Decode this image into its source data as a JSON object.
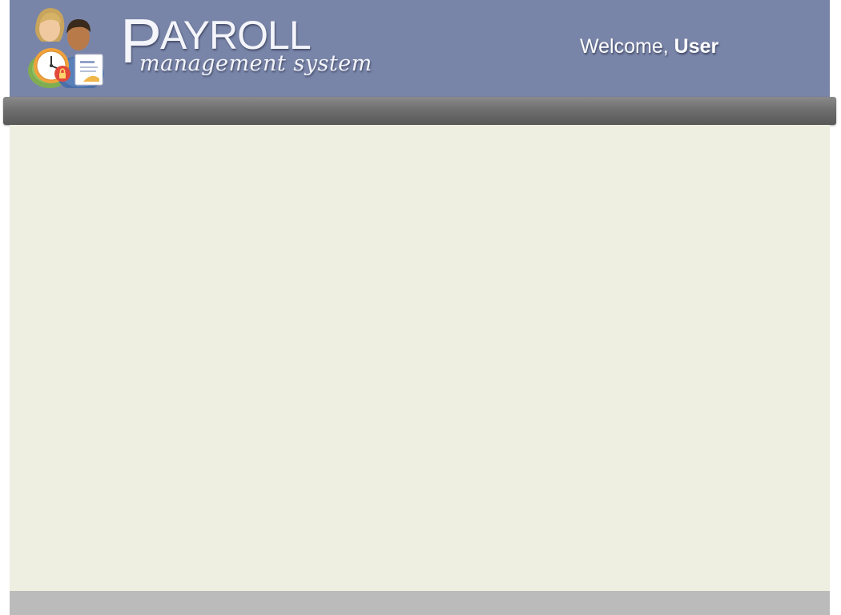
{
  "header": {
    "logo_icon": "payroll-people-clock-icon",
    "brand": {
      "first_letter": "P",
      "rest": "AYROLL",
      "subtitle": "management system"
    },
    "welcome": {
      "greeting": "Welcome,",
      "username": "User"
    }
  },
  "colors": {
    "header_bg": "#7985a8",
    "navbar": "#6f6f6f",
    "content_bg": "#eeefe0",
    "footer_bg": "#bbbbbb"
  }
}
